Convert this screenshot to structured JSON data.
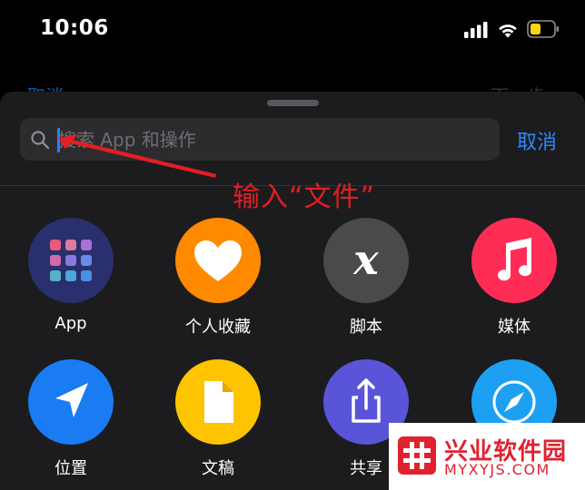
{
  "status_bar": {
    "time": "10:06"
  },
  "background_page": {
    "left_label": "取消",
    "right_label": "下一步"
  },
  "search": {
    "placeholder": "搜索 App 和操作",
    "value": "",
    "cancel_label": "取消"
  },
  "annotation": {
    "text": "输入“文件”"
  },
  "grid": {
    "items": [
      {
        "label": "App",
        "icon": "app-grid-icon",
        "color": "#2a2f6e"
      },
      {
        "label": "个人收藏",
        "icon": "heart-icon",
        "color": "#ff8a00"
      },
      {
        "label": "脚本",
        "icon": "script-x-icon",
        "color": "#4a4a4c"
      },
      {
        "label": "媒体",
        "icon": "music-note-icon",
        "color": "#ff2d55"
      },
      {
        "label": "位置",
        "icon": "location-arrow-icon",
        "color": "#1a7cf2"
      },
      {
        "label": "文稿",
        "icon": "document-icon",
        "color": "#ffc400"
      },
      {
        "label": "共享",
        "icon": "share-icon",
        "color": "#5a55d8"
      },
      {
        "label": "",
        "icon": "compass-icon",
        "color": "#1ea0f2"
      }
    ]
  },
  "watermark": {
    "title": "兴业软件园",
    "url": "MYXYJS.COM"
  },
  "colors": {
    "accent": "#2f86ff",
    "annotation": "#e31e24",
    "sheet": "#1c1c1e"
  }
}
